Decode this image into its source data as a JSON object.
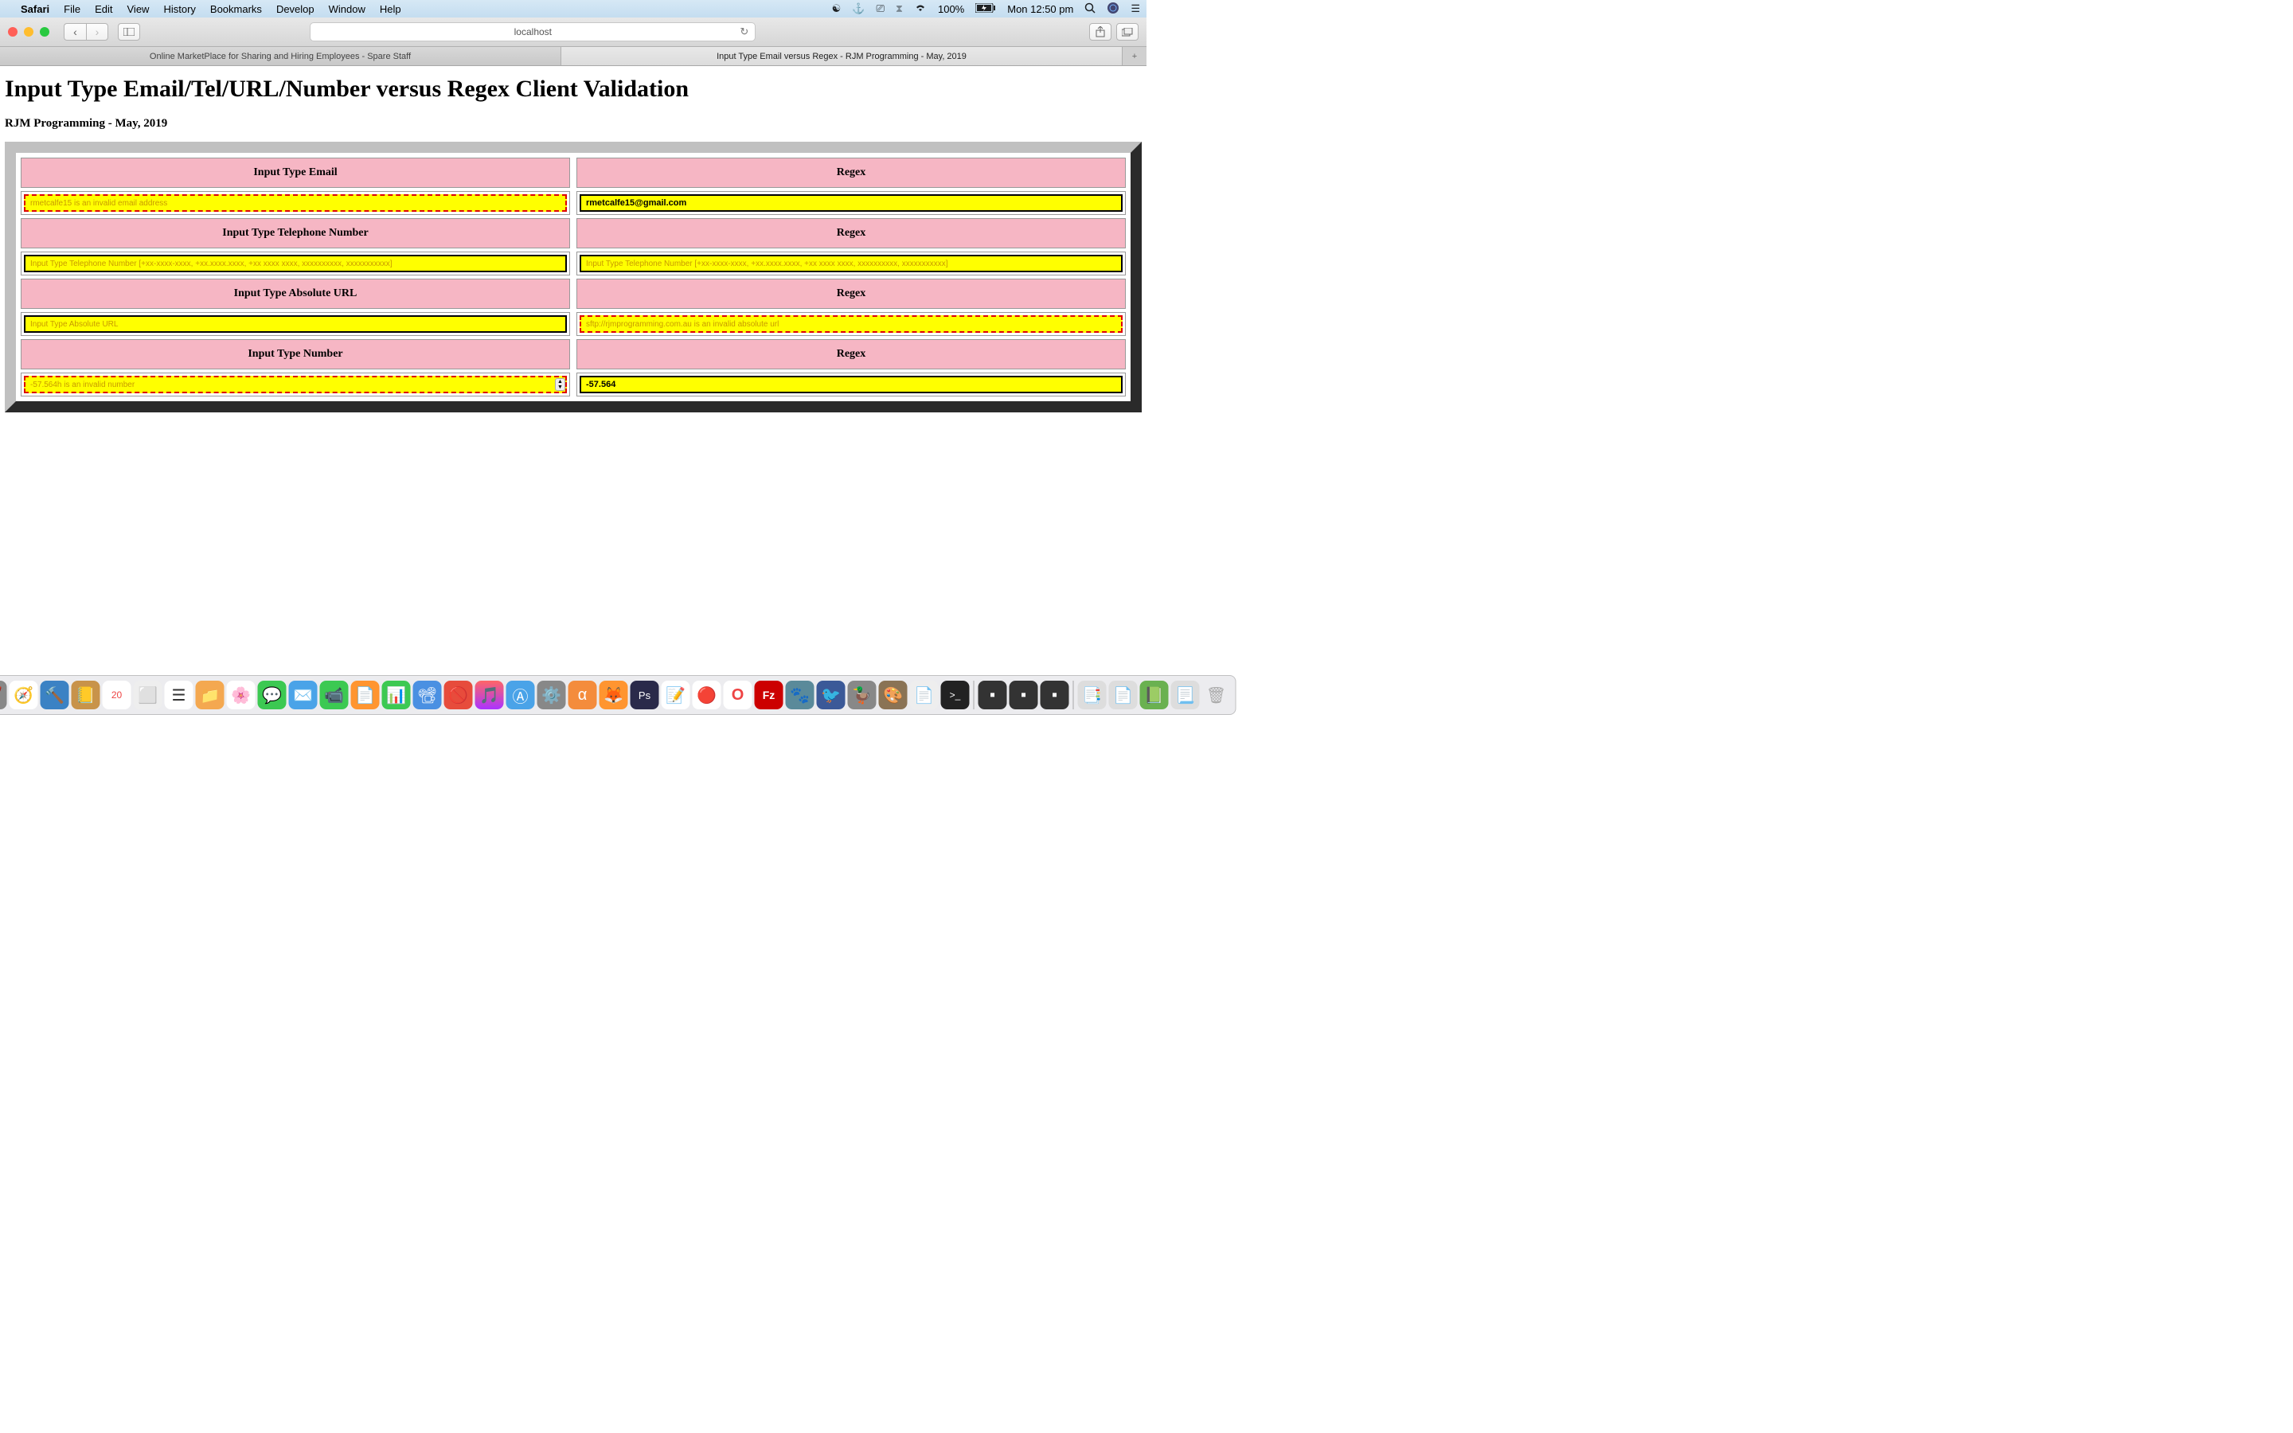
{
  "menubar": {
    "app": "Safari",
    "items": [
      "File",
      "Edit",
      "View",
      "History",
      "Bookmarks",
      "Develop",
      "Window",
      "Help"
    ],
    "battery": "100%",
    "clock": "Mon 12:50 pm"
  },
  "toolbar": {
    "url": "localhost"
  },
  "tabs": {
    "inactive": "Online MarketPlace for Sharing and Hiring Employees - Spare Staff",
    "active": "Input Type Email versus Regex - RJM Programming - May, 2019"
  },
  "page": {
    "title": "Input Type Email/Tel/URL/Number versus Regex Client Validation",
    "subtitle": "RJM Programming - May, 2019",
    "headers": {
      "email": "Input Type Email",
      "tel": "Input Type Telephone Number",
      "url": "Input Type Absolute URL",
      "number": "Input Type Number",
      "regex": "Regex"
    },
    "fields": {
      "email_left": "rmetcalfe15 is an invalid email address",
      "email_right": "rmetcalfe15@gmail.com",
      "tel_placeholder": "Input Type Telephone Number [+xx-xxxx-xxxx, +xx.xxxx.xxxx, +xx xxxx xxxx, xxxxxxxxxx, xxxxxxxxxxx]",
      "url_placeholder": "Input Type Absolute URL",
      "url_right": "sftp://rjmprogramming.com.au is an invalid absolute url",
      "number_left": "-57.564h is an invalid number",
      "number_right": "-57.564"
    }
  }
}
